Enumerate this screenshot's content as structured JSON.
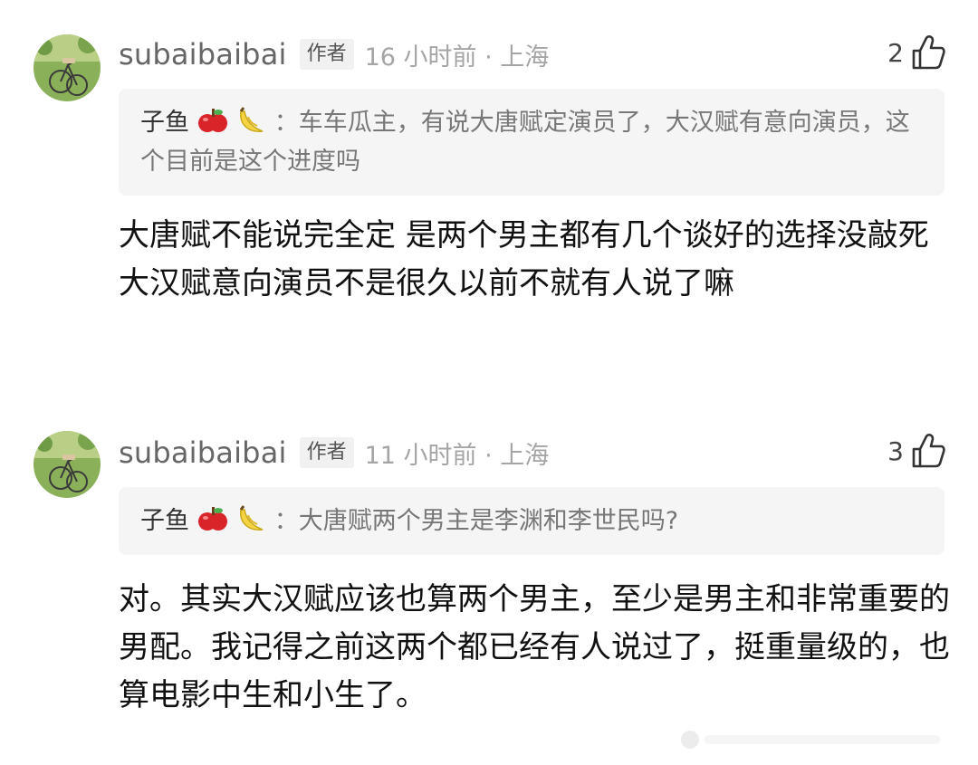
{
  "comments": [
    {
      "username": "subaibaibai",
      "badge": "作者",
      "meta": "16 小时前 · 上海",
      "likes": "2",
      "quote": {
        "name": "子鱼",
        "separator": "：",
        "text": "车车瓜主，有说大唐赋定演员了，大汉赋有意向演员，这个目前是这个进度吗"
      },
      "body": "大唐赋不能说完全定 是两个男主都有几个谈好的选择没敲死  大汉赋意向演员不是很久以前不就有人说了嘛"
    },
    {
      "username": "subaibaibai",
      "badge": "作者",
      "meta": "11 小时前 · 上海",
      "likes": "3",
      "quote": {
        "name": "子鱼",
        "separator": "：",
        "text": "大唐赋两个男主是李渊和李世民吗?"
      },
      "body": "对。其实大汉赋应该也算两个男主，至少是男主和非常重要的男配。我记得之前这两个都已经有人说过了，挺重量级的，也算电影中生和小生了。"
    }
  ],
  "icons": {
    "like": "thumbs-up-icon",
    "emoji_1": "apple-emoji",
    "emoji_2": "banana-emoji",
    "avatar": "bicycle-avatar"
  },
  "colors": {
    "username": "#666666",
    "meta": "#a5a5a5",
    "quote_bg": "#f5f5f5",
    "badge_bg": "#f1f1f1"
  }
}
